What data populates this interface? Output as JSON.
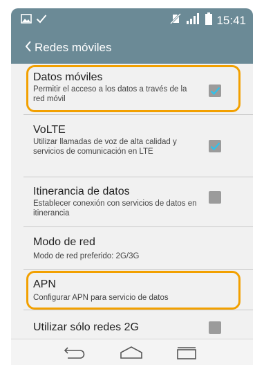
{
  "status_bar": {
    "time": "15:41",
    "left_icons": [
      "image-icon",
      "check-icon"
    ],
    "right_icons": [
      "no-sim-icon",
      "signal-icon",
      "battery-icon"
    ]
  },
  "app_bar": {
    "title": "Redes móviles",
    "back_icon": "chevron-left-icon"
  },
  "settings": [
    {
      "title": "Datos móviles",
      "subtitle": "Permitir el acceso a los datos a través de la red móvil",
      "checkbox": true,
      "checked": true
    },
    {
      "title": "VoLTE",
      "subtitle": "Utilizar llamadas de voz de alta calidad y servicios de comunicación en LTE",
      "checkbox": true,
      "checked": true
    },
    {
      "title": "Itinerancia de datos",
      "subtitle": "Establecer conexión con servicios de datos en itinerancia",
      "checkbox": true,
      "checked": false
    },
    {
      "title": "Modo de red",
      "subtitle": "Modo de red preferido: 2G/3G",
      "checkbox": false
    },
    {
      "title": "APN",
      "subtitle": "Configurar APN para servicio de datos",
      "checkbox": false
    },
    {
      "title": "Utilizar sólo redes 2G",
      "subtitle": "",
      "checkbox": true,
      "checked": false
    }
  ],
  "highlighted_items": [
    "Datos móviles",
    "APN"
  ],
  "nav_bar": [
    "back-icon",
    "home-icon",
    "recents-icon"
  ],
  "colors": {
    "bar": "#6b8a96",
    "highlight": "#f2a000",
    "check": "#2bc3ee",
    "checkbox": "#9b9b9b",
    "background": "#f1f1f1"
  }
}
